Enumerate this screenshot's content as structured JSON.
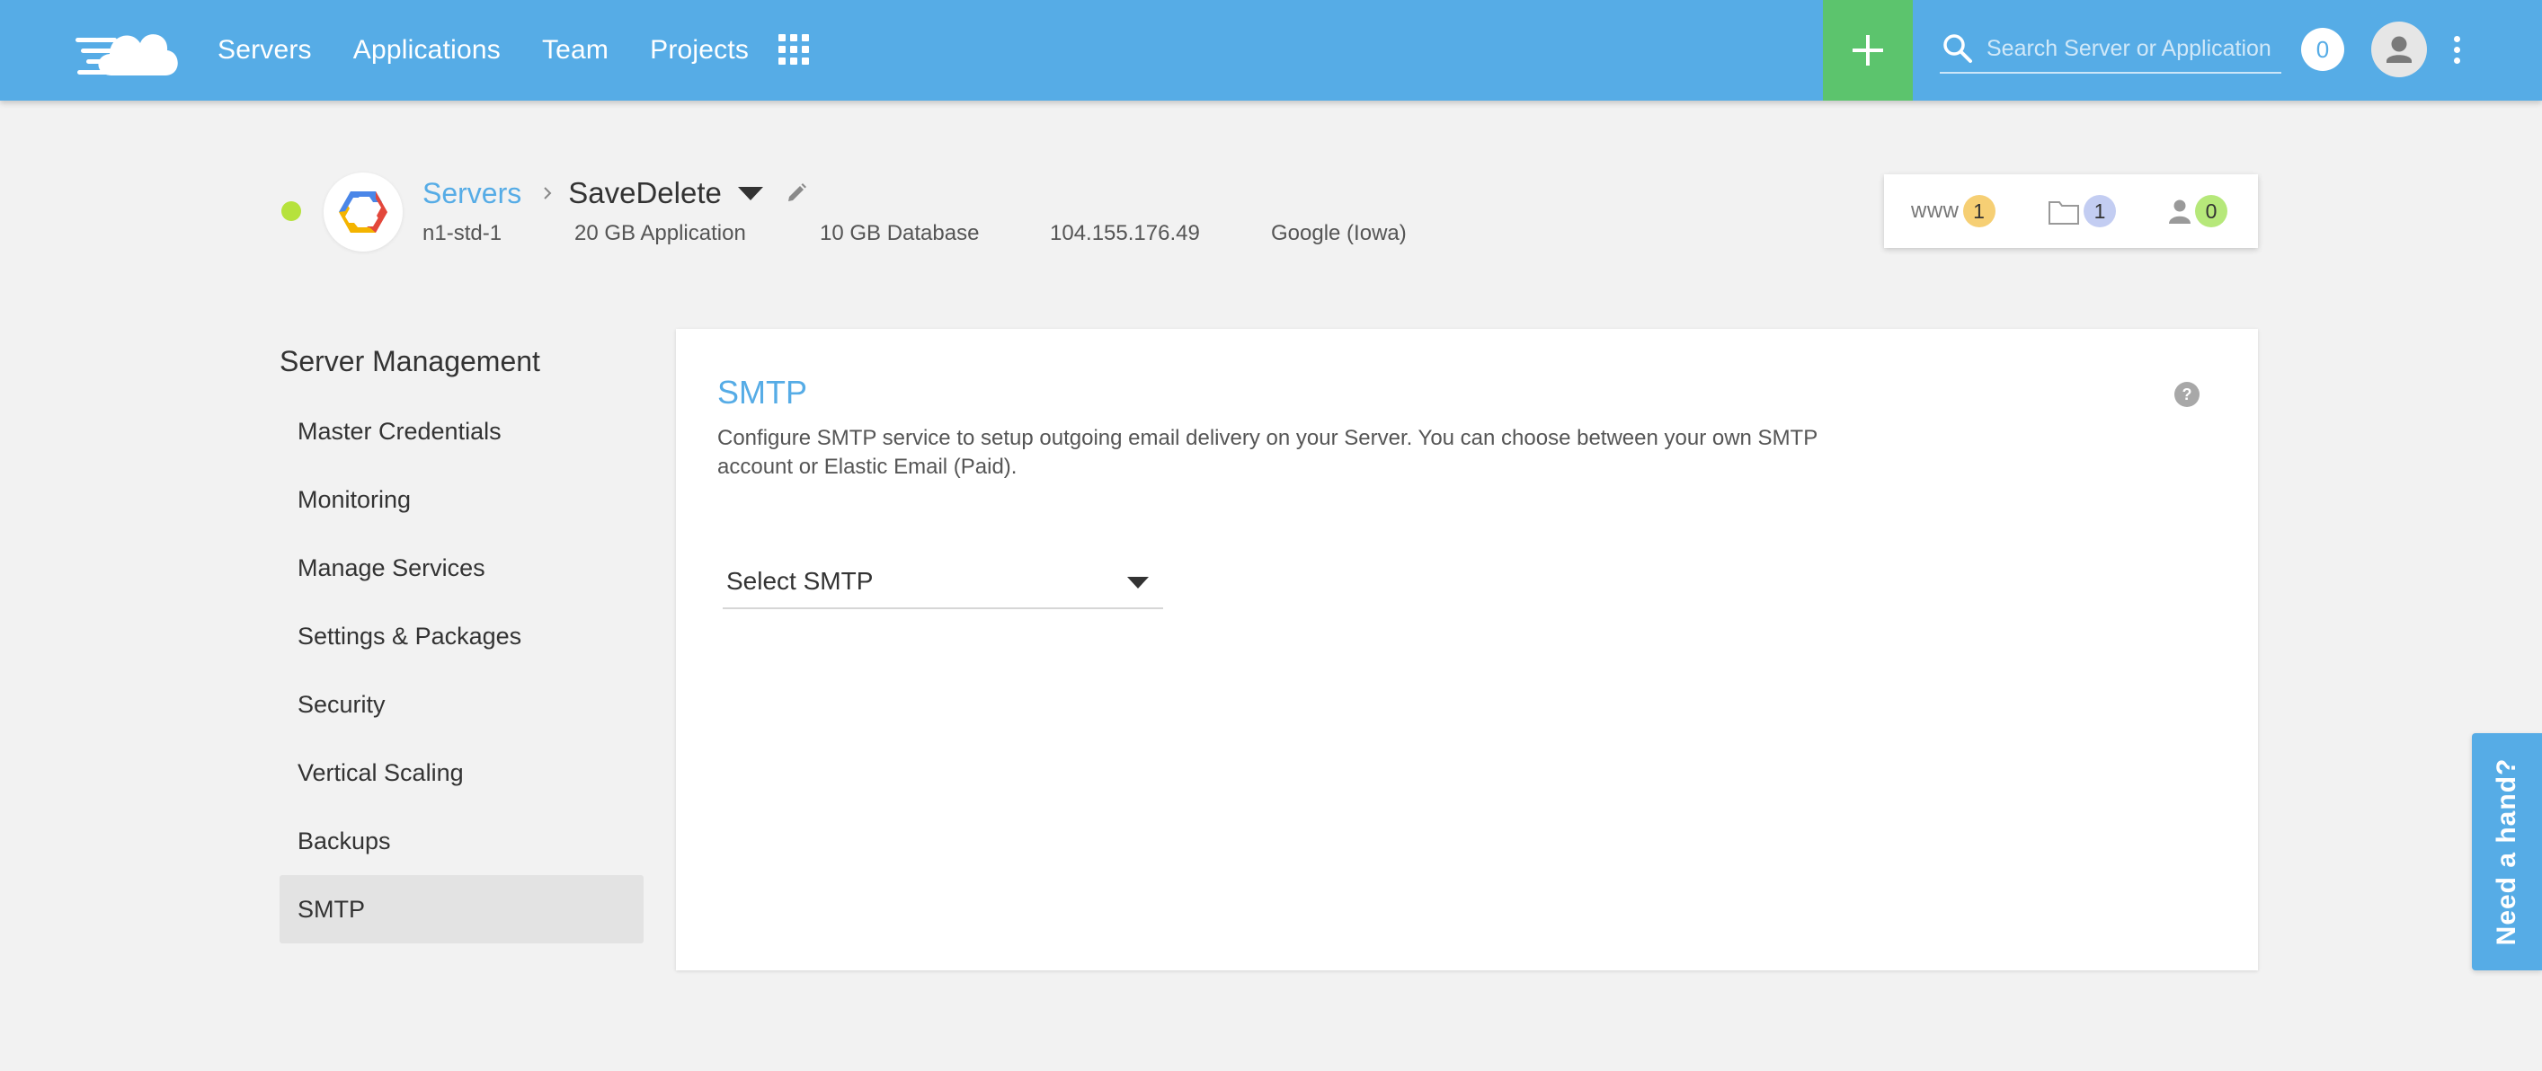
{
  "colors": {
    "accent": "#56ace6",
    "add": "#5cc46d",
    "status_online": "#b6e23c"
  },
  "topbar": {
    "nav": [
      "Servers",
      "Applications",
      "Team",
      "Projects"
    ],
    "search_placeholder": "Search Server or Application",
    "notifications": "0"
  },
  "server": {
    "breadcrumb_root": "Servers",
    "name": "SaveDelete",
    "meta": {
      "size": "n1-std-1",
      "app_storage": "20 GB Application",
      "db_storage": "10 GB Database",
      "ip": "104.155.176.49",
      "location": "Google (Iowa)"
    },
    "stats": {
      "www_label": "www",
      "www": "1",
      "files": "1",
      "users": "0"
    }
  },
  "sidebar": {
    "title": "Server Management",
    "items": [
      {
        "label": "Master Credentials"
      },
      {
        "label": "Monitoring"
      },
      {
        "label": "Manage Services"
      },
      {
        "label": "Settings & Packages"
      },
      {
        "label": "Security"
      },
      {
        "label": "Vertical Scaling"
      },
      {
        "label": "Backups"
      },
      {
        "label": "SMTP"
      }
    ],
    "active": "SMTP"
  },
  "main": {
    "title": "SMTP",
    "description": "Configure SMTP service to setup outgoing email delivery on your Server. You can choose between your own SMTP account or Elastic Email (Paid).",
    "select_label": "Select SMTP"
  },
  "help_tab": "Need a hand?"
}
